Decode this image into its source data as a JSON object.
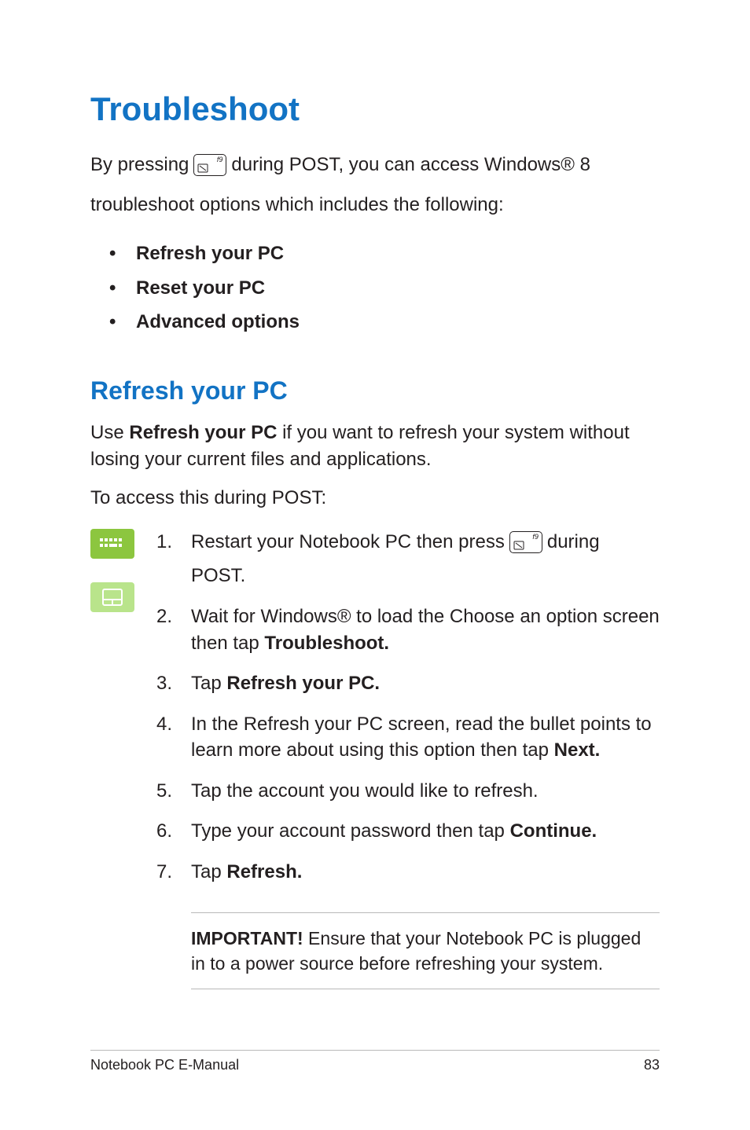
{
  "heading": "Troubleshoot",
  "intro": {
    "prefix": "By pressing",
    "key_label": "f9",
    "suffix": "during POST, you can access Windows® 8",
    "line2": "troubleshoot options which includes the following:"
  },
  "top_bullets": [
    "Refresh your PC",
    "Reset your PC",
    "Advanced options"
  ],
  "section2_heading": "Refresh your PC",
  "section2_para": {
    "pre": "Use ",
    "bold": "Refresh your PC",
    "post": " if you want to refresh your system without losing your current files and applications."
  },
  "section2_lead": "To access this during POST:",
  "steps": {
    "s1": {
      "pre": "Restart your Notebook PC then press",
      "key_label": "f9",
      "post": "during",
      "line2": "POST."
    },
    "s2": {
      "pre": "Wait for Windows® to load the Choose an option screen then tap ",
      "bold": "Troubleshoot."
    },
    "s3": {
      "pre": "Tap ",
      "bold": "Refresh your PC."
    },
    "s4": {
      "pre": "In the Refresh your PC screen, read the bullet points to learn more about using this option then tap ",
      "bold": "Next."
    },
    "s5": {
      "text": "Tap the account you would like to refresh."
    },
    "s6": {
      "pre": "Type your account password then tap ",
      "bold": "Continue."
    },
    "s7": {
      "pre": "Tap ",
      "bold": "Refresh."
    }
  },
  "callout": {
    "bold": "IMPORTANT!",
    "text": " Ensure that your Notebook PC is plugged in to a power source before refreshing your system."
  },
  "footer": {
    "left": "Notebook PC E-Manual",
    "right": "83"
  }
}
